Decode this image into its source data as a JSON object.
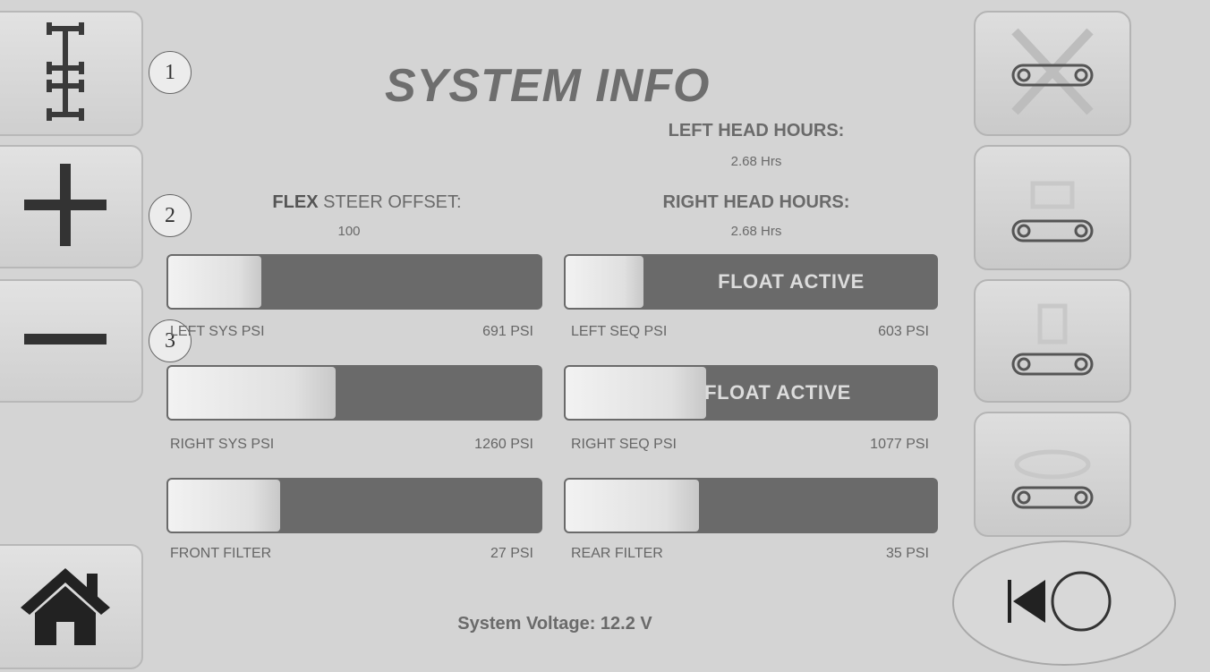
{
  "title": "SYSTEM INFO",
  "left_head_hours": {
    "label": "LEFT HEAD HOURS:",
    "value": "2.68 Hrs"
  },
  "right_head_hours": {
    "label": "RIGHT HEAD HOURS:",
    "value": "2.68 Hrs"
  },
  "flex_steer": {
    "label_bold": "FLEX",
    "label_rest": " STEER OFFSET:",
    "value": "100"
  },
  "gauges": [
    {
      "label": "LEFT SYS PSI",
      "value": "691 PSI",
      "level": 0.25,
      "overlay": ""
    },
    {
      "label": "LEFT SEQ PSI",
      "value": "603 PSI",
      "level": 0.21,
      "overlay": "FLOAT ACTIVE"
    },
    {
      "label": "RIGHT SYS PSI",
      "value": "1260 PSI",
      "level": 0.45,
      "overlay": ""
    },
    {
      "label": "RIGHT SEQ PSI",
      "value": "1077 PSI",
      "level": 0.38,
      "overlay": "FLOAT ACTIVE"
    },
    {
      "label": "FRONT FILTER",
      "value": "27 PSI",
      "level": 0.3,
      "overlay": ""
    },
    {
      "label": "REAR FILTER",
      "value": "35 PSI",
      "level": 0.36,
      "overlay": ""
    }
  ],
  "voltage": "System Voltage: 12.2 V",
  "callouts": [
    "1",
    "2",
    "3"
  ],
  "left_buttons": [
    "axle-config-icon",
    "plus-icon",
    "minus-icon",
    "home-icon"
  ],
  "right_buttons": [
    "header-disabled-icon",
    "header-raise-icon",
    "header-mid-icon",
    "header-lower-icon"
  ],
  "back_button_icon": "back-arrow-circle-icon",
  "colors": {
    "background": "#d4d4d4",
    "gauge_track": "#6a6a6a",
    "gauge_fill": "#eeeeee",
    "text": "#666666"
  }
}
